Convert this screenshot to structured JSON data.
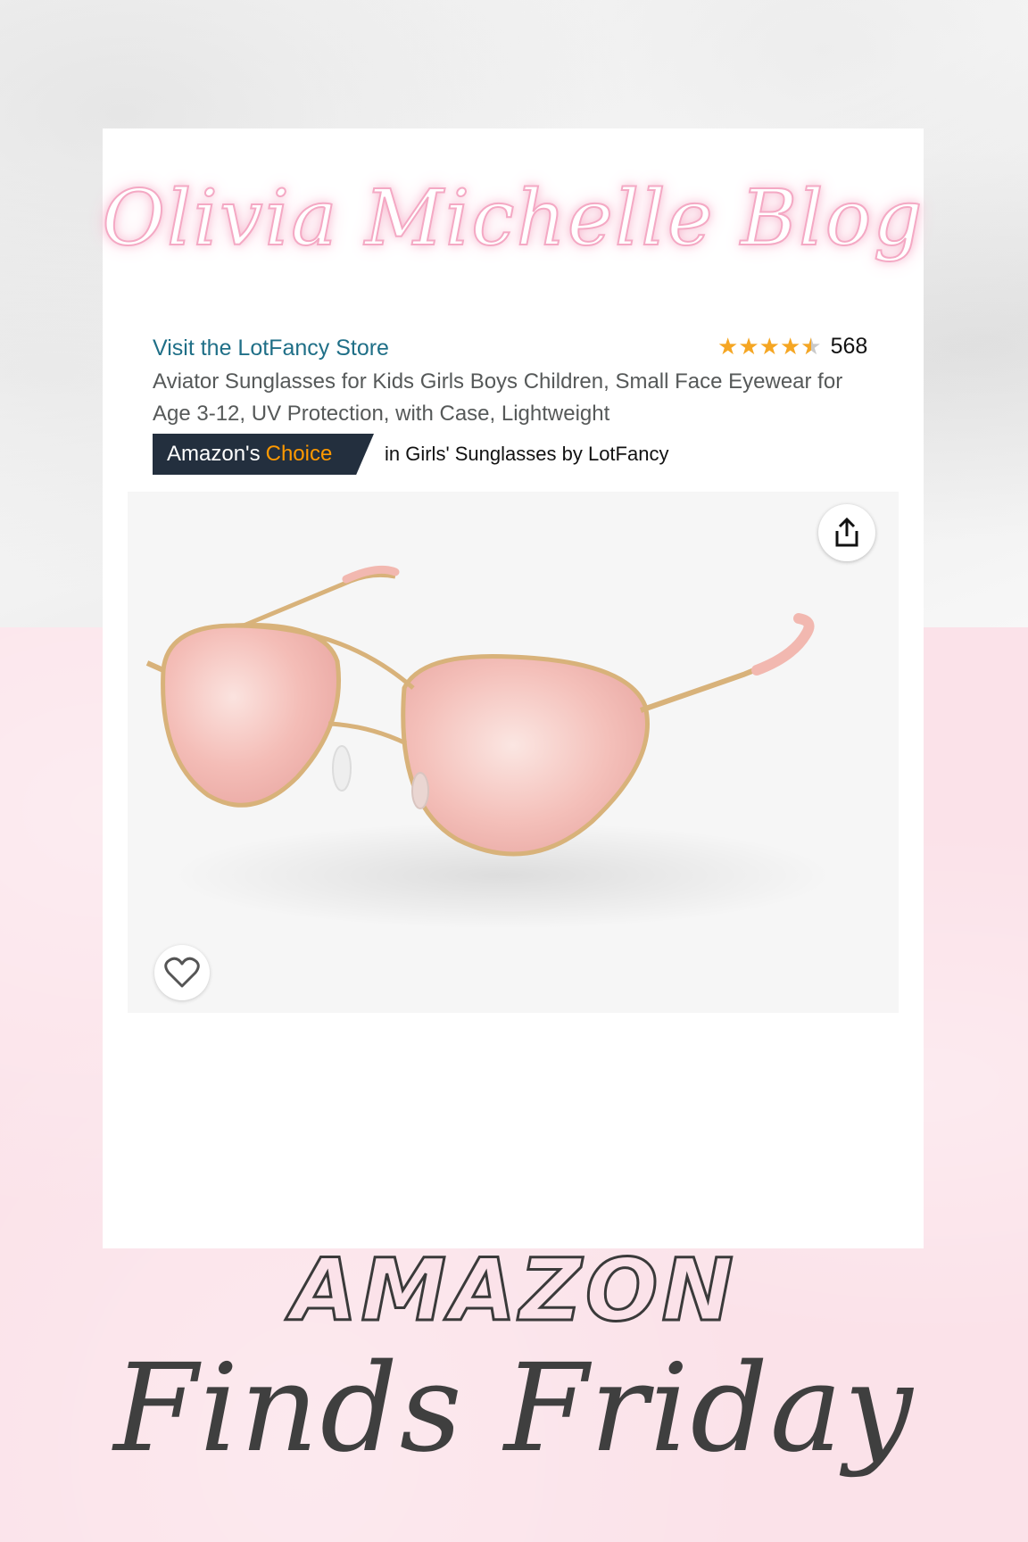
{
  "blog": {
    "title": "Olivia Michelle Blog"
  },
  "product": {
    "store_link": "Visit the LotFancy Store",
    "rating_count": "568",
    "title": "Aviator Sunglasses for Kids Girls Boys Children, Small Face Eyewear for Age 3-12, UV Protection, with Case, Lightweight",
    "badge_prefix": "Amazon's",
    "badge_choice": "Choice",
    "badge_context": "in Girls' Sunglasses by LotFancy",
    "rating_stars": 4.5
  },
  "icons": {
    "share": "share-icon",
    "heart": "heart-icon",
    "star": "star-icon"
  },
  "footer": {
    "line1": "AMAZON",
    "line2": "Finds Friday"
  },
  "colors": {
    "link": "#1f6f87",
    "star": "#f5a623",
    "badge_bg": "#232f3e",
    "badge_choice": "#ff9900",
    "pink_bg": "#fbe2e9",
    "neon_pink": "#f4a9c4",
    "frame_gold": "#d8b27a",
    "lens_pink": "#f3b3b0"
  }
}
